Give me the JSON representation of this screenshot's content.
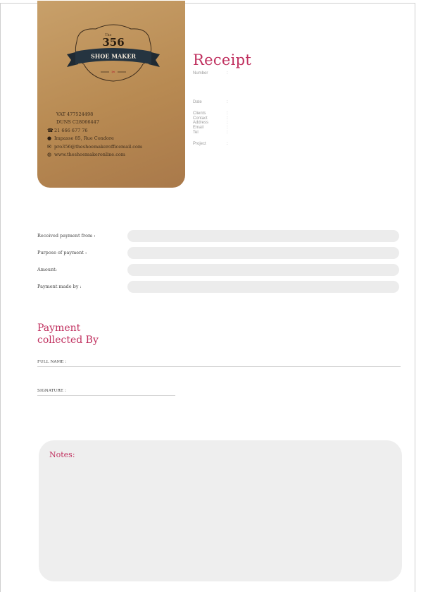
{
  "brand": {
    "logo_number": "356",
    "logo_prefix": "The",
    "logo_name": "SHOE MAKER",
    "logo_tagline": "CUSTOM",
    "vat": "VAT 477524498",
    "company_no": "DUNS C28066447",
    "phone": "21 666 677 76",
    "address": "Impasse 85, Rue Condore",
    "email": "pro356@theshoemakerofficemail.com",
    "website": "www.theshoemakeronline.com"
  },
  "receipt": {
    "title": "Receipt",
    "number_label": "Number",
    "date_label": "Date",
    "client_labels": [
      "Clients",
      "Contact",
      "Address",
      "Email",
      "Tel"
    ],
    "project_label": "Project"
  },
  "payment": {
    "rows": [
      {
        "label": "Received payment from :"
      },
      {
        "label": "Purpose of payment :"
      },
      {
        "label": "Amount:"
      },
      {
        "label": "Payment made by :"
      }
    ]
  },
  "collected": {
    "title_line1": "Payment",
    "title_line2": "collected By",
    "full_name_label": "FULL NAME :",
    "signature_label": "SIGNATURE :"
  },
  "notes": {
    "title": "Notes:"
  },
  "colors": {
    "accent": "#c0305f",
    "card": "#b88a52",
    "field": "#ececec"
  }
}
